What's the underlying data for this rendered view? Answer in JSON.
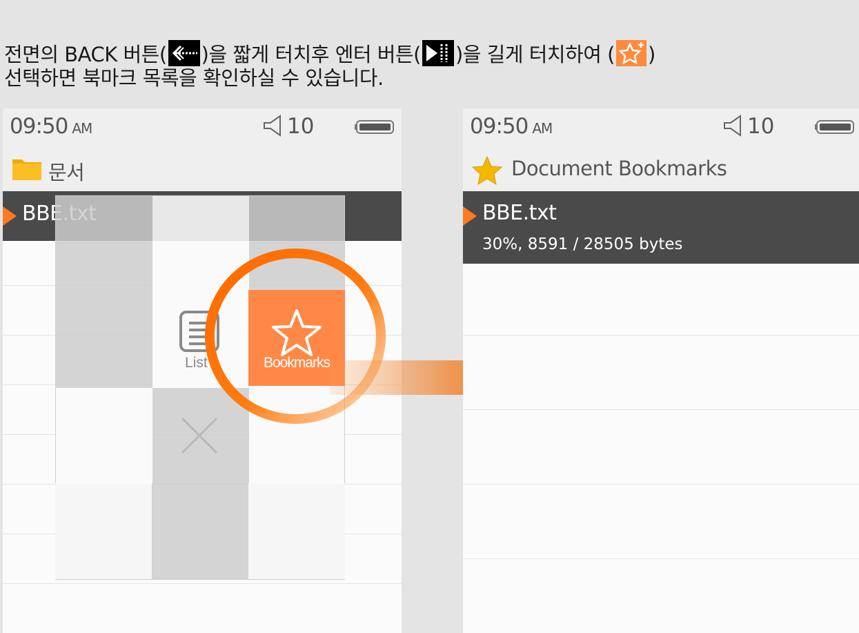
{
  "instruction": {
    "line1_a": "전면의 BACK 버튼(",
    "line1_b": ")을 짧게 터치후 엔터 버튼(",
    "line1_c": ")을 길게 터치하여 (",
    "line1_d": ")",
    "line2": "선택하면 북마크 목록을 확인하실 수 있습니다.",
    "icons": [
      "back-arrow-icon",
      "enter-icon",
      "bookmark-add-icon"
    ]
  },
  "left_screen": {
    "status": {
      "time": "09:50",
      "ampm": "AM",
      "volume": "10"
    },
    "folder_title": "문서",
    "selected_file": "BBE.txt",
    "menu": {
      "list_label": "List",
      "bookmarks_label": "Bookmarks"
    }
  },
  "right_screen": {
    "status": {
      "time": "09:50",
      "ampm": "AM",
      "volume": "10"
    },
    "title": "Document Bookmarks",
    "bookmark": {
      "file": "BBE.txt",
      "info": "30%, 8591 / 28505 bytes"
    }
  },
  "colors": {
    "accent": "#ff7a22",
    "selected_row": "#4a4a4a",
    "star": "#f5b800"
  }
}
